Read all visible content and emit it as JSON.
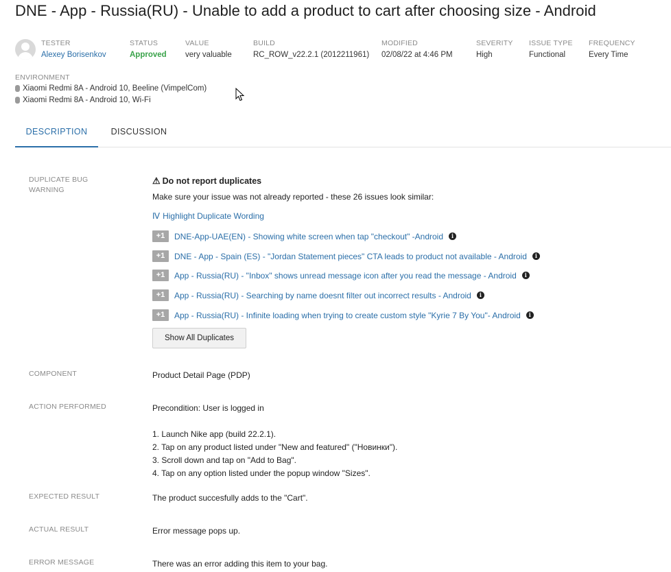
{
  "issue": {
    "title": "DNE - App - Russia(RU) - Unable to add a product to cart after choosing size - Android"
  },
  "meta": {
    "tester": {
      "label": "TESTER",
      "value": "Alexey Borisenkov"
    },
    "status": {
      "label": "STATUS",
      "value": "Approved"
    },
    "value": {
      "label": "VALUE",
      "value": "very valuable"
    },
    "build": {
      "label": "BUILD",
      "value": "RC_ROW_v22.2.1 (2012211961)"
    },
    "modified": {
      "label": "MODIFIED",
      "value": "02/08/22 at 4:46 PM"
    },
    "severity": {
      "label": "SEVERITY",
      "value": "High"
    },
    "issue_type": {
      "label": "ISSUE TYPE",
      "value": "Functional"
    },
    "frequency": {
      "label": "FREQUENCY",
      "value": "Every Time"
    }
  },
  "environment": {
    "label": "ENVIRONMENT",
    "items": [
      "Xiaomi Redmi 8A - Android 10, Beeline (VimpelCom)",
      "Xiaomi Redmi 8A - Android 10, Wi-Fi"
    ]
  },
  "tabs": [
    {
      "label": "DESCRIPTION",
      "active": true
    },
    {
      "label": "DISCUSSION",
      "active": false
    }
  ],
  "duplicate_warning": {
    "label": "DUPLICATE BUG WARNING",
    "heading": "Do not report duplicates",
    "intro": "Make sure your issue was not already reported - these 26 issues look similar:",
    "highlight_link": "Highlight Duplicate Wording",
    "plus_label": "+1",
    "items": [
      "DNE-App-UAE(EN) - Showing white screen when tap \"checkout\" -Android",
      "DNE - App - Spain (ES) - \"Jordan Statement pieces\" CTA leads to product not available - Android",
      "App - Russia(RU) - \"Inbox\" shows unread message icon after you read the message - Android",
      "App - Russia(RU) - Searching by name doesnt filter out incorrect results - Android",
      "App - Russia(RU) - Infinite loading when trying to create custom style \"Kyrie 7 By You\"- Android"
    ],
    "show_all_label": "Show All Duplicates"
  },
  "fields": {
    "component": {
      "label": "COMPONENT",
      "value": "Product Detail Page (PDP)"
    },
    "action_performed": {
      "label": "ACTION PERFORMED",
      "precondition": "Precondition: User is logged in",
      "steps": [
        "1. Launch Nike app (build 22.2.1).",
        "2. Tap on any product listed under \"New and featured\" (\"Новинки\").",
        "3. Scroll down and tap on \"Add to Bag\".",
        "4. Tap on any option listed under the popup window \"Sizes\"."
      ]
    },
    "expected_result": {
      "label": "EXPECTED RESULT",
      "value": "The product succesfully adds to the \"Cart\"."
    },
    "actual_result": {
      "label": "ACTUAL RESULT",
      "value": "Error message pops up."
    },
    "error_message": {
      "label": "ERROR MESSAGE",
      "value": "There was an error adding this item to your bag."
    }
  },
  "colors": {
    "link": "#2a6ea8",
    "approved": "#3aa34a",
    "label": "#8a8a8a",
    "plus_button": "#a7a7a7"
  },
  "icons": {
    "warning": "warning-icon",
    "info": "info-icon",
    "highlight": "text-cursor-icon",
    "avatar": "user-avatar-icon",
    "device": "phone-icon"
  }
}
